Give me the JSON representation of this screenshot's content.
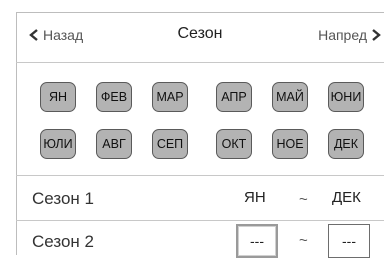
{
  "header": {
    "back_label": "Назад",
    "title": "Сезон",
    "next_label": "Напред"
  },
  "months": [
    "ЯН",
    "ФЕВ",
    "МАР",
    "АПР",
    "МАЙ",
    "ЮНИ",
    "ЮЛИ",
    "АВГ",
    "СЕП",
    "ОКТ",
    "НОЕ",
    "ДЕК"
  ],
  "seasons": [
    {
      "label": "Сезон 1",
      "start": "ЯН",
      "separator": "~",
      "end": "ДЕК"
    },
    {
      "label": "Сезон 2",
      "start": "---",
      "separator": "~",
      "end": "---"
    }
  ],
  "icons": {
    "back": "chevron-left-icon",
    "next": "chevron-right-icon"
  }
}
